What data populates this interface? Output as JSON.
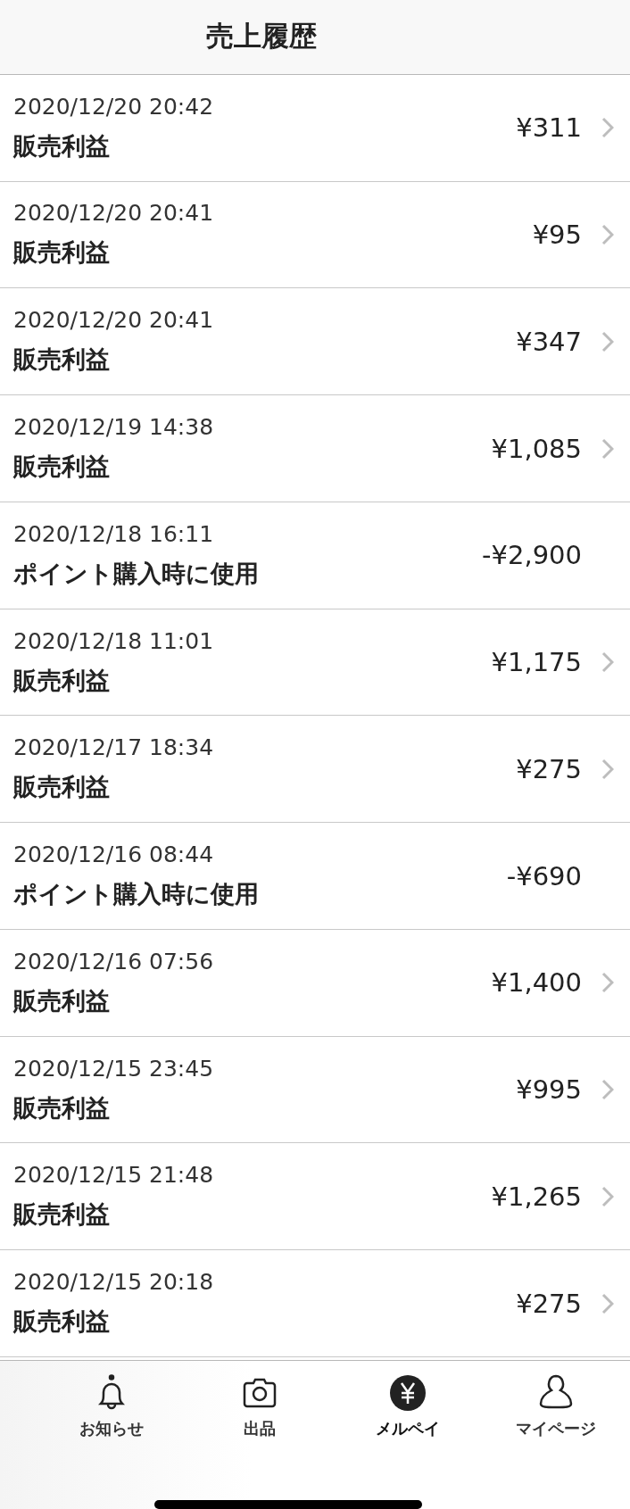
{
  "header": {
    "title": "売上履歴"
  },
  "transactions": [
    {
      "date": "2020/12/20 20:42",
      "label": "販売利益",
      "amount": "¥311",
      "chevron": true
    },
    {
      "date": "2020/12/20 20:41",
      "label": "販売利益",
      "amount": "¥95",
      "chevron": true
    },
    {
      "date": "2020/12/20 20:41",
      "label": "販売利益",
      "amount": "¥347",
      "chevron": true
    },
    {
      "date": "2020/12/19 14:38",
      "label": "販売利益",
      "amount": "¥1,085",
      "chevron": true
    },
    {
      "date": "2020/12/18 16:11",
      "label": "ポイント購入時に使用",
      "amount": "-¥2,900",
      "chevron": false
    },
    {
      "date": "2020/12/18 11:01",
      "label": "販売利益",
      "amount": "¥1,175",
      "chevron": true
    },
    {
      "date": "2020/12/17 18:34",
      "label": "販売利益",
      "amount": "¥275",
      "chevron": true
    },
    {
      "date": "2020/12/16 08:44",
      "label": "ポイント購入時に使用",
      "amount": "-¥690",
      "chevron": false
    },
    {
      "date": "2020/12/16 07:56",
      "label": "販売利益",
      "amount": "¥1,400",
      "chevron": true
    },
    {
      "date": "2020/12/15 23:45",
      "label": "販売利益",
      "amount": "¥995",
      "chevron": true
    },
    {
      "date": "2020/12/15 21:48",
      "label": "販売利益",
      "amount": "¥1,265",
      "chevron": true
    },
    {
      "date": "2020/12/15 20:18",
      "label": "販売利益",
      "amount": "¥275",
      "chevron": true
    }
  ],
  "tab_bar": [
    {
      "kind": "bell",
      "label": "お知らせ",
      "selected": false
    },
    {
      "kind": "camera",
      "label": "出品",
      "selected": false
    },
    {
      "kind": "yen",
      "label": "メルペイ",
      "selected": true
    },
    {
      "kind": "person",
      "label": "マイページ",
      "selected": false
    }
  ]
}
